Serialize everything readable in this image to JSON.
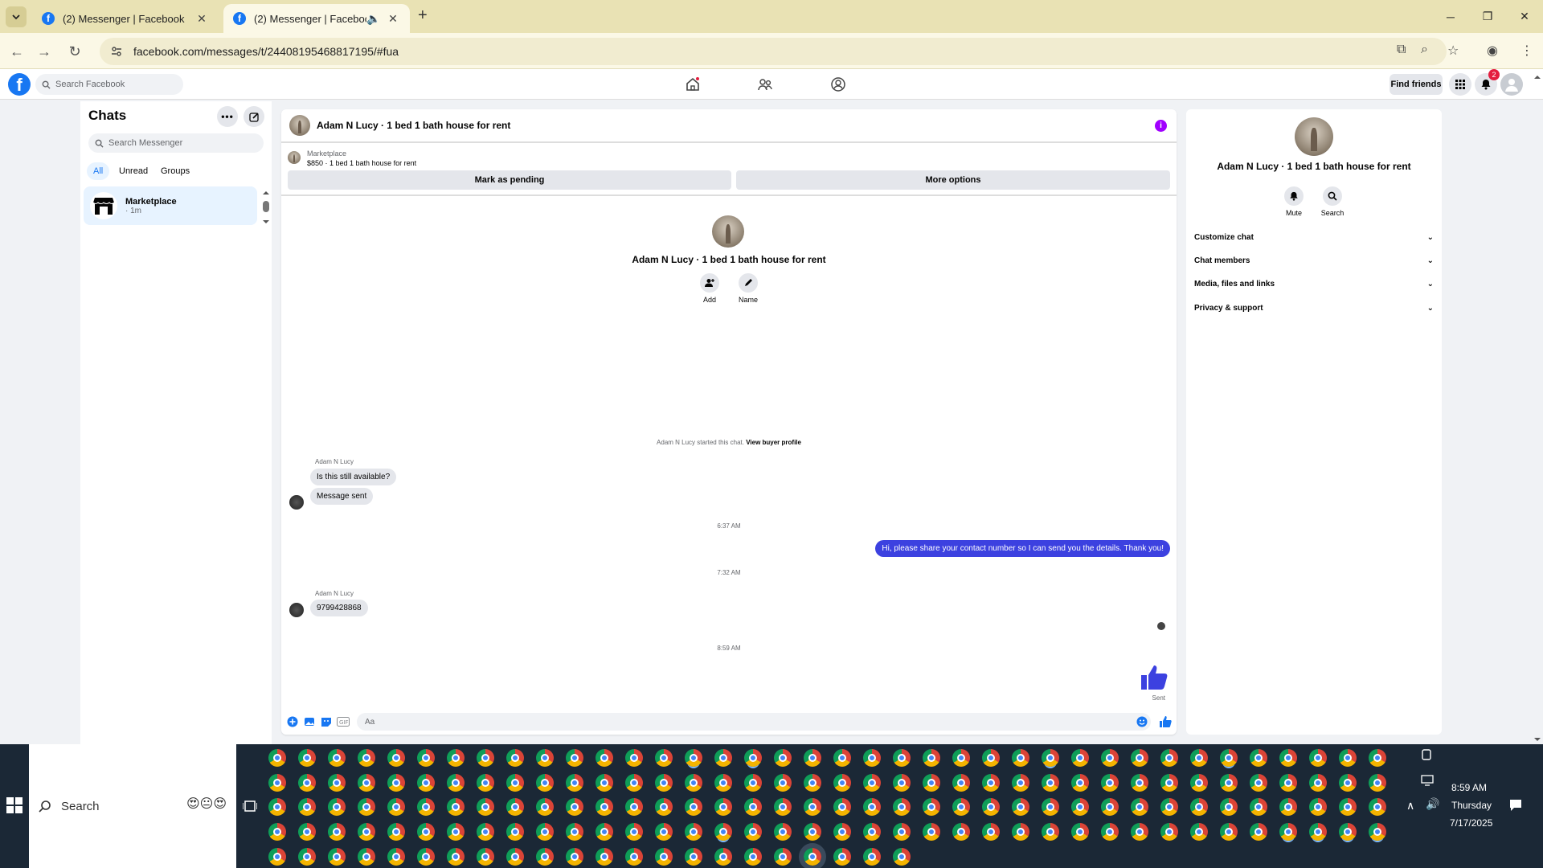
{
  "browser": {
    "tabs": [
      {
        "title": "(2) Messenger | Facebook",
        "active": false
      },
      {
        "title": "(2) Messenger | Facebook",
        "active": true
      }
    ],
    "url": "facebook.com/messages/t/24408195468817195/#fua"
  },
  "fb_header": {
    "search_placeholder": "Search Facebook",
    "find_friends": "Find friends",
    "notification_count": "2"
  },
  "sidebar": {
    "title": "Chats",
    "search_placeholder": "Search Messenger",
    "filters": [
      "All",
      "Unread",
      "Groups"
    ],
    "chats": [
      {
        "name": "Marketplace",
        "time": "· 1m"
      }
    ]
  },
  "conversation": {
    "title": "Adam N Lucy · 1 bed 1 bath house for rent",
    "marketplace_label": "Marketplace",
    "listing": "$850 · 1 bed 1 bath house for rent",
    "mark_pending": "Mark as pending",
    "more_options": "More options",
    "center_name": "Adam N Lucy · 1 bed 1 bath house for rent",
    "actions": {
      "add": "Add",
      "name": "Name"
    },
    "system_text": "Adam N Lucy started this chat.",
    "view_profile": "View buyer profile",
    "sender": "Adam N Lucy",
    "msg1": "Is this still available?",
    "msg2": "Message sent",
    "ts1": "6:37 AM",
    "out_msg": "Hi, please share your contact number so I can send you the details. Thank you!",
    "ts2": "7:32 AM",
    "msg3": "9799428868",
    "ts3": "8:59 AM",
    "sent_label": "Sent",
    "composer_placeholder": "Aa"
  },
  "right_panel": {
    "name": "Adam N Lucy · 1 bed 1 bath house for rent",
    "mute": "Mute",
    "search": "Search",
    "sections": [
      "Customize chat",
      "Chat members",
      "Media, files and links",
      "Privacy & support"
    ]
  },
  "taskbar": {
    "search_label": "Search",
    "time": "8:59 AM",
    "day": "Thursday",
    "date": "7/17/2025"
  },
  "colors": {
    "accent": "#1877f2",
    "outgoing_bubble": "#3c41e0",
    "info": "#a100ff"
  }
}
